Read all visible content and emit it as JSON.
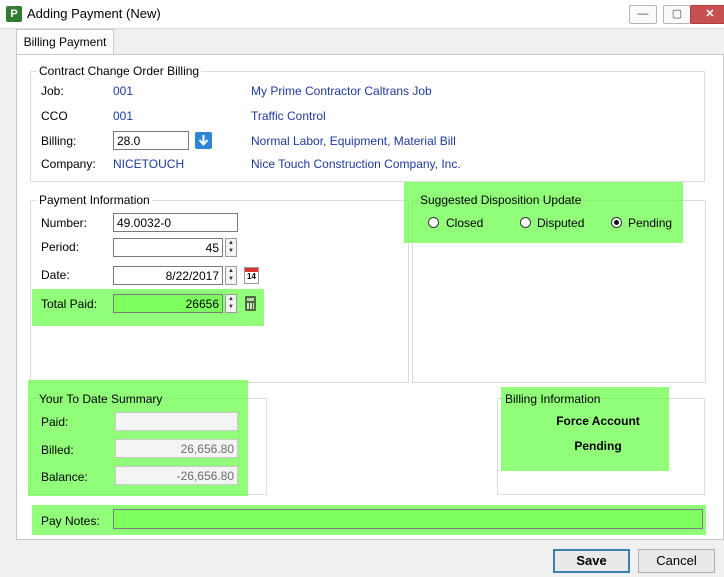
{
  "window": {
    "title": "Adding Payment  (New)",
    "app_letter": "P",
    "minimize": "—",
    "maximize": "▢",
    "close": "✕"
  },
  "tabs": [
    {
      "label": "Billing Payment"
    }
  ],
  "contract": {
    "title": "Contract Change Order Billing",
    "job_label": "Job:",
    "job_value": "001",
    "job_desc": "My Prime Contractor Caltrans Job",
    "cco_label": "CCO",
    "cco_value": "001",
    "cco_desc": "Traffic Control",
    "billing_label": "Billing:",
    "billing_value": "28.0",
    "billing_desc": "Normal Labor, Equipment, Material Bill",
    "company_label": "Company:",
    "company_value": "NICETOUCH",
    "company_desc": "Nice Touch Construction Company, Inc."
  },
  "payment": {
    "title": "Payment Information",
    "number_label": "Number:",
    "number_value": "49.0032-0",
    "period_label": "Period:",
    "period_value": "45",
    "date_label": "Date:",
    "date_value": "8/22/2017",
    "total_label": "Total Paid:",
    "total_value": "26656",
    "calendar_day": "14"
  },
  "disposition": {
    "title": "Suggested Disposition Update",
    "options": [
      {
        "label": "Closed",
        "selected": false
      },
      {
        "label": "Disputed",
        "selected": false
      },
      {
        "label": "Pending",
        "selected": true
      }
    ]
  },
  "summary": {
    "title": "Your To Date Summary",
    "paid_label": "Paid:",
    "paid_value": "",
    "billed_label": "Billed:",
    "billed_value": "26,656.80",
    "balance_label": "Balance:",
    "balance_value": "-26,656.80"
  },
  "billing_info": {
    "title": "Billing Information",
    "line1": "Force Account",
    "line2": "Pending"
  },
  "notes": {
    "label": "Pay Notes:",
    "value": ""
  },
  "buttons": {
    "save": "Save",
    "cancel": "Cancel"
  },
  "colors": {
    "highlight": "#66ff47",
    "link_blue": "#1f3aa0",
    "primary_border": "#3c7fb1"
  }
}
